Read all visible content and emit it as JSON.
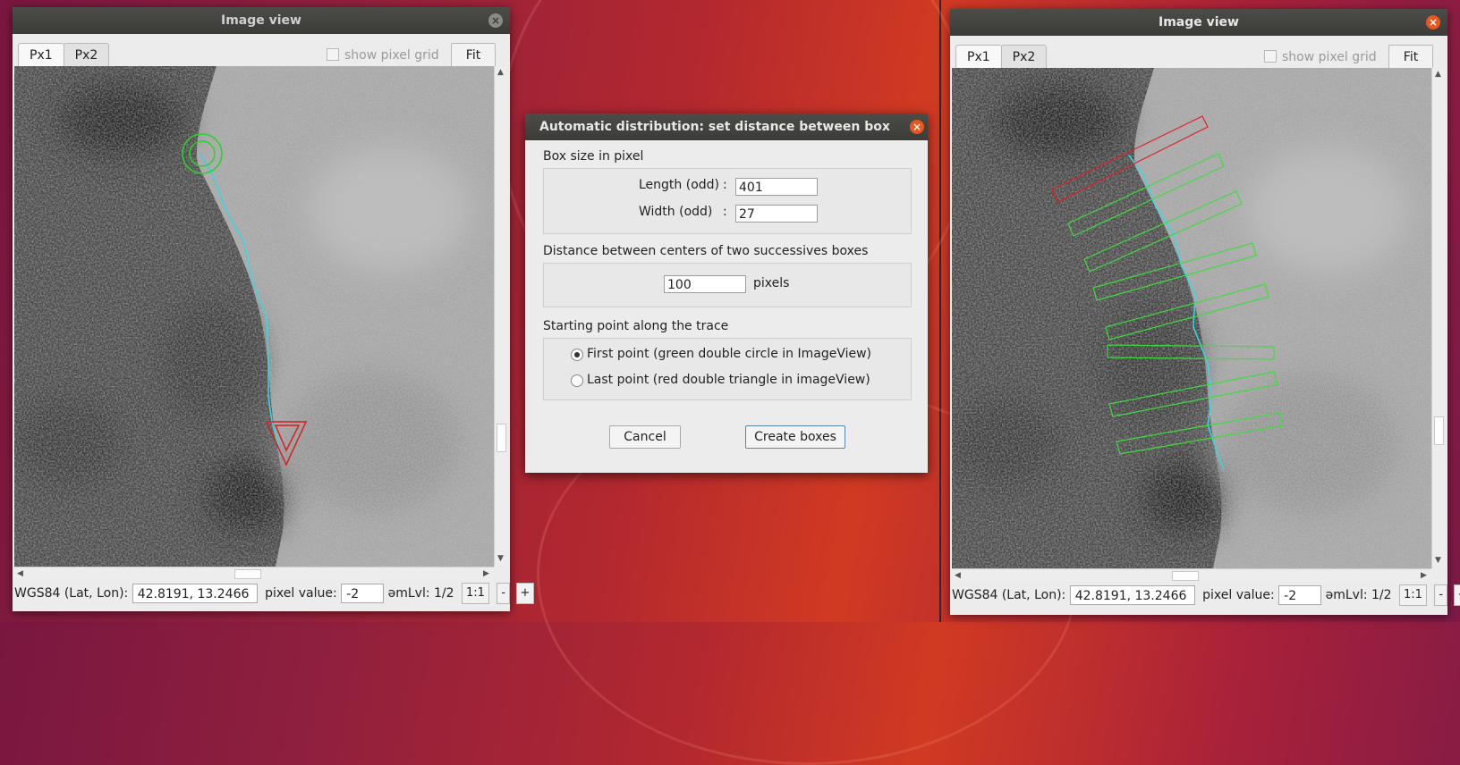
{
  "left_window": {
    "title": "Image view",
    "tabs": [
      "Px1",
      "Px2"
    ],
    "show_grid_label": "show pixel grid",
    "fit_label": "Fit",
    "status": {
      "coord_label": "WGS84 (Lat, Lon):",
      "coord_value": "42.8191, 13.2466",
      "pixel_label": "pixel value:",
      "pixel_value": "-2",
      "zoom_label": "əmLvl: 1/2",
      "one_to_one": "1:1",
      "minus": "-",
      "plus": "+"
    }
  },
  "right_window": {
    "title": "Image view",
    "tabs": [
      "Px1",
      "Px2"
    ],
    "show_grid_label": "show pixel grid",
    "fit_label": "Fit",
    "status": {
      "coord_label": "WGS84 (Lat, Lon):",
      "coord_value": "42.8191, 13.2466",
      "pixel_label": "pixel value:",
      "pixel_value": "-2",
      "zoom_label": "əmLvl: 1/2",
      "one_to_one": "1:1",
      "minus": "-",
      "plus": "+"
    }
  },
  "dialog": {
    "title": "Automatic distribution: set distance between box centers",
    "box_size_heading": "Box size in pixel",
    "length_label": "Length (odd)",
    "length_value": "401",
    "width_label": "Width (odd)",
    "width_value": "27",
    "colon": ":",
    "distance_heading": "Distance between centers of two successives boxes",
    "distance_value": "100",
    "distance_unit": "pixels",
    "start_heading": "Starting point along the trace",
    "option_first": "First point (green double circle in ImageView)",
    "option_last": "Last point (red double triangle in imageView)",
    "selected_option": "first",
    "cancel_label": "Cancel",
    "create_label": "Create boxes"
  },
  "colors": {
    "trace": "#3ad6e6",
    "start_marker": "#2bd12b",
    "end_marker": "#d42020",
    "boxes": "#3fdc3f",
    "first_box": "#e02020",
    "close_active": "#e9561e"
  }
}
